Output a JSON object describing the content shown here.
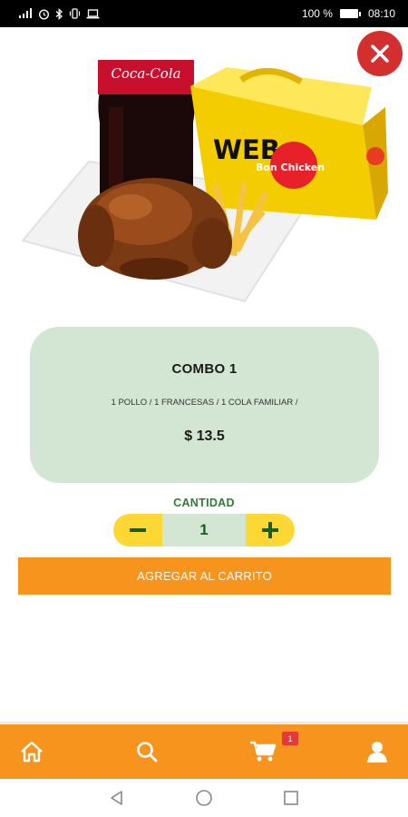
{
  "status_bar": {
    "battery_percent": "100 %",
    "time": "08:10"
  },
  "product": {
    "image_icon": "chicken-combo-photo",
    "name": "COMBO 1",
    "description": "1 POLLO / 1 FRANCESAS / 1 COLA FAMILIAR /",
    "price": "$ 13.5",
    "image_text": {
      "soda_brand": "Coca-Cola",
      "box_brand_line1": "WEB",
      "box_brand_line2": "Bon Chicken"
    }
  },
  "quantity": {
    "label": "CANTIDAD",
    "value": "1",
    "minus_label": "−",
    "plus_label": "+"
  },
  "actions": {
    "add_to_cart_label": "AGREGAR AL CARRITO"
  },
  "bottom_nav": {
    "items": [
      {
        "icon": "home-icon"
      },
      {
        "icon": "search-icon"
      },
      {
        "icon": "cart-icon"
      },
      {
        "icon": "user-icon"
      }
    ],
    "cart_badge": "1"
  },
  "colors": {
    "accent_orange": "#f7941d",
    "card_green": "#d3e6d3",
    "stepper_yellow": "#fdd835",
    "text_green": "#2e7d32",
    "close_red": "#d32f2f"
  }
}
